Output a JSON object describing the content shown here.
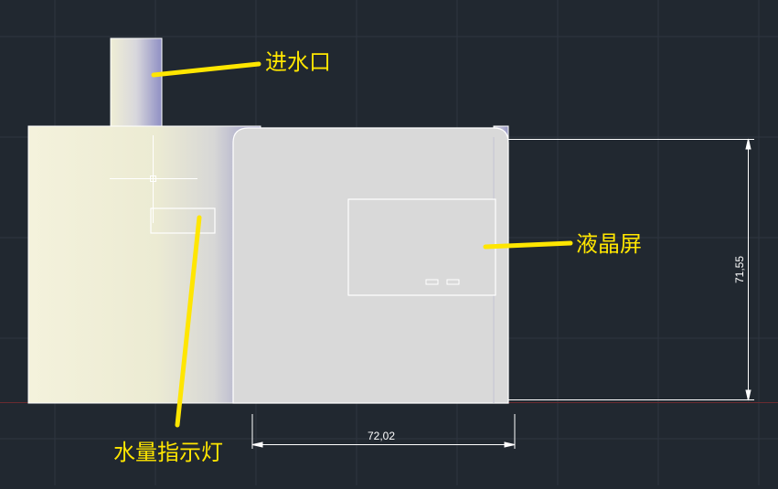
{
  "labels": {
    "inlet": "进水口",
    "lcd": "液晶屏",
    "water_indicator": "水量指示灯"
  },
  "dimensions": {
    "width": "72,02",
    "height": "71,55"
  },
  "colors": {
    "background": "#212830",
    "grid": "#2e3640",
    "callout": "#ffe600",
    "outline": "#ffffff",
    "tank_light": "#f4f2dc",
    "tank_shade": "#9c9cc8",
    "panel": "#d9d9d9",
    "baseline": "#6b2b30"
  }
}
